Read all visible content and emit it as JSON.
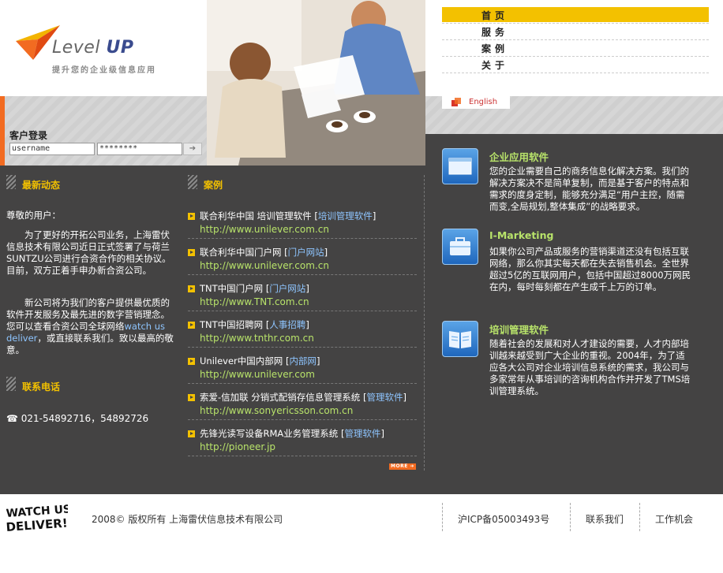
{
  "logo": {
    "brand_prefix": "Level",
    "brand_suffix": "UP",
    "tagline": "提升您的企业级信息应用"
  },
  "login": {
    "title": "客户登录",
    "username_value": "username",
    "password_value": "********",
    "submit_icon": "arrow-right-icon"
  },
  "nav": {
    "items": [
      "首页",
      "服务",
      "案例",
      "关于"
    ],
    "active_index": 0,
    "language_link": "English"
  },
  "news": {
    "heading": "最新动态",
    "greeting": "尊敬的用户：",
    "paragraph1": "为了更好的开拓公司业务，上海雷伏信息技术有限公司近日正式签署了与荷兰SUNTZU公司进行合资合作的相关协议。目前，双方正着手申办新合资公司。",
    "paragraph2_before": "新公司将为我们的客户提供最优质的软件开发服务及最先进的数字营销理念。您可以查看合资公司全球网络",
    "paragraph2_link": "watch us deliver",
    "paragraph2_after": "，或直接联系我们。致以最高的敬意。"
  },
  "contact": {
    "heading": "联系电话",
    "phone_icon": "phone-icon",
    "phone": "021-54892716，54892726"
  },
  "cases": {
    "heading": "案例",
    "items": [
      {
        "title": "联合利华中国 培训管理软件 ",
        "tag": "培训管理软件",
        "url": "http://www.unilever.com.cn"
      },
      {
        "title": "联合利华中国门户网 ",
        "tag": "门户网站",
        "url": "http://www.unilever.com.cn"
      },
      {
        "title": "TNT中国门户网 ",
        "tag": "门户网站",
        "url": "http://www.TNT.com.cn"
      },
      {
        "title": "TNT中国招聘网 ",
        "tag": "人事招聘",
        "url": "http://www.tnthr.com.cn"
      },
      {
        "title": "Unilever中国内部网 ",
        "tag": "内部网",
        "url": "http://www.unilever.com"
      },
      {
        "title": "索爱-信加联 分销式配销存信息管理系统 ",
        "tag": "管理软件",
        "url": "http://www.sonyericsson.com.cn"
      },
      {
        "title": "先锋光读写设备RMA业务管理系统 ",
        "tag": "管理软件",
        "url": "http://pioneer.jp"
      }
    ],
    "more_label": "MORE"
  },
  "services": [
    {
      "icon": "window-icon",
      "title": "企业应用软件",
      "desc": "您的企业需要自己的商务信息化解决方案。我们的解决方案决不是简单复制，而是基于客户的特点和需求的度身定制，能够充分满足“用户主控，随需而变,全局规划,整体集成”的战略要求。"
    },
    {
      "icon": "briefcase-icon",
      "title": "I-Marketing",
      "desc": "如果你公司产品或服务的营销渠道还没有包括互联网络，那么你其实每天都在失去销售机会。全世界超过5亿的互联网用户，包括中国超过8000万网民在内，每时每刻都在产生成千上万的订单。"
    },
    {
      "icon": "book-icon",
      "title": "培训管理软件",
      "desc": "随着社会的发展和对人才建设的需要，人才内部培训越来越受到广大企业的重视。2004年，为了适应各大公司对企业培训信息系统的需求，我公司与多家常年从事培训的咨询机构合作并开发了TMS培训管理系统。"
    }
  ],
  "footer": {
    "logo_text": "WATCH US DELIVER!",
    "copyright": "2008© 版权所有 上海雷伏信息技术有限公司",
    "icp": "沪ICP备05003493号",
    "contact_link": "联系我们",
    "jobs_link": "工作机会"
  },
  "colors": {
    "accent_yellow": "#f3c100",
    "accent_orange": "#f26b21",
    "dark_bg": "#444343",
    "link_green": "#b8e36a",
    "link_blue": "#8ec5ff"
  }
}
